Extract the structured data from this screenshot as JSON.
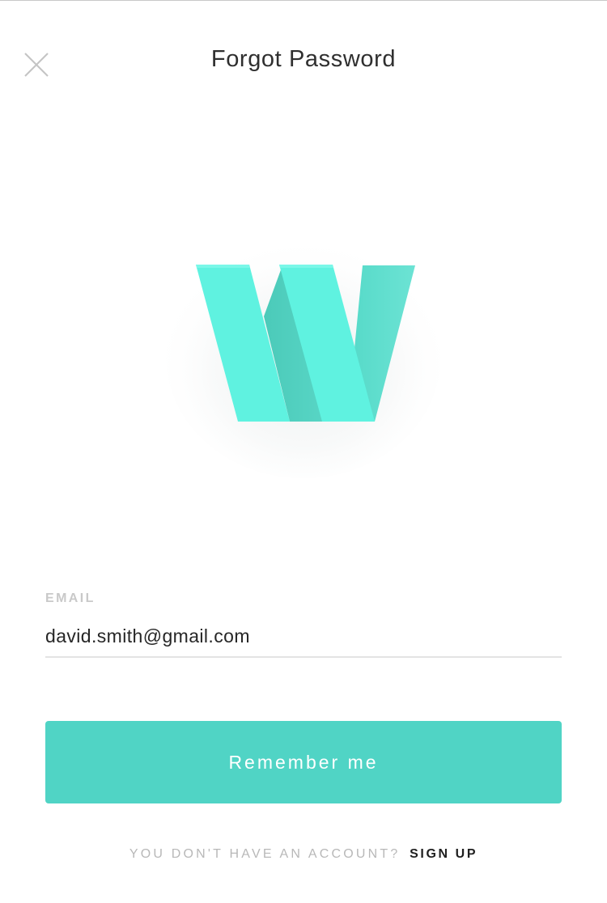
{
  "header": {
    "title": "Forgot Password",
    "close_icon": "close-icon"
  },
  "logo": {
    "letter": "W",
    "icon": "brand-w-logo-icon",
    "color": "#5ef0df"
  },
  "form": {
    "email_label": "EMAIL",
    "email_value": "david.smith@gmail.com"
  },
  "primary_button": {
    "label": "Remember me",
    "color": "#50d4c5"
  },
  "footer": {
    "prompt": "YOU DON'T HAVE AN ACCOUNT?",
    "link": "SIGN UP"
  }
}
